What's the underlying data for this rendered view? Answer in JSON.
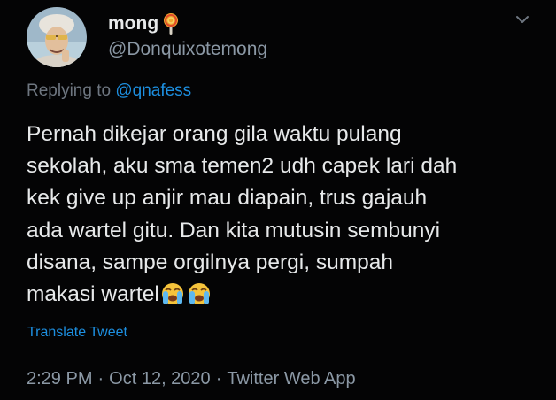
{
  "user": {
    "display_name": "mong",
    "handle": "@Donquixotemong",
    "name_emoji": "lollipop-icon"
  },
  "reply": {
    "prefix": "Replying to",
    "mention": "@qnafess"
  },
  "tweet": {
    "lines": [
      "Pernah dikejar orang gila waktu pulang",
      "sekolah, aku sma temen2 udh capek lari dah",
      "kek give up anjir mau diapain, trus gajauh",
      "ada wartel gitu. Dan kita mutusin sembunyi",
      "disana, sampe orgilnya pergi, sumpah",
      "makasi wartel"
    ],
    "trailing_emoji": [
      "loudly-crying-face-icon",
      "loudly-crying-face-icon"
    ]
  },
  "translate_label": "Translate Tweet",
  "meta": {
    "time": "2:29 PM",
    "date": "Oct 12, 2020",
    "source": "Twitter Web App",
    "separator": "·"
  },
  "colors": {
    "background": "#040405",
    "text": "#e7e9ea",
    "secondary": "#8b98a5",
    "link": "#1d8fe0"
  }
}
